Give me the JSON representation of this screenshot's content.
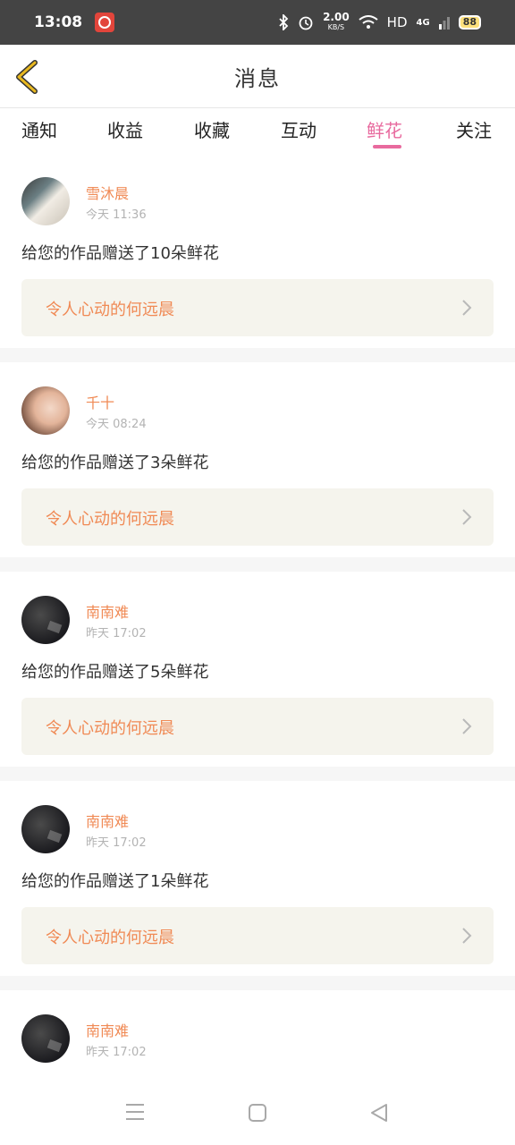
{
  "status_bar": {
    "time": "13:08",
    "net_speed_value": "2.00",
    "net_speed_unit": "KB/S",
    "hd": "HD",
    "network": "4G",
    "battery": "88"
  },
  "header": {
    "title": "消息"
  },
  "tabs": [
    {
      "label": "通知"
    },
    {
      "label": "收益"
    },
    {
      "label": "收藏"
    },
    {
      "label": "互动"
    },
    {
      "label": "鲜花",
      "active": true
    },
    {
      "label": "关注"
    }
  ],
  "notifications": [
    {
      "username": "雪沐晨",
      "time": "今天 11:36",
      "message": "给您的作品赠送了10朵鲜花",
      "work_title": "令人心动的何远晨"
    },
    {
      "username": "千十",
      "time": "今天 08:24",
      "message": "给您的作品赠送了3朵鲜花",
      "work_title": "令人心动的何远晨"
    },
    {
      "username": "南南难",
      "time": "昨天 17:02",
      "message": "给您的作品赠送了5朵鲜花",
      "work_title": "令人心动的何远晨"
    },
    {
      "username": "南南难",
      "time": "昨天 17:02",
      "message": "给您的作品赠送了1朵鲜花",
      "work_title": "令人心动的何远晨"
    },
    {
      "username": "南南难",
      "time": "昨天 17:02"
    }
  ],
  "colors": {
    "accent_pink": "#e86a9e",
    "accent_orange": "#f08a55",
    "back_arrow": "#e8b820"
  }
}
